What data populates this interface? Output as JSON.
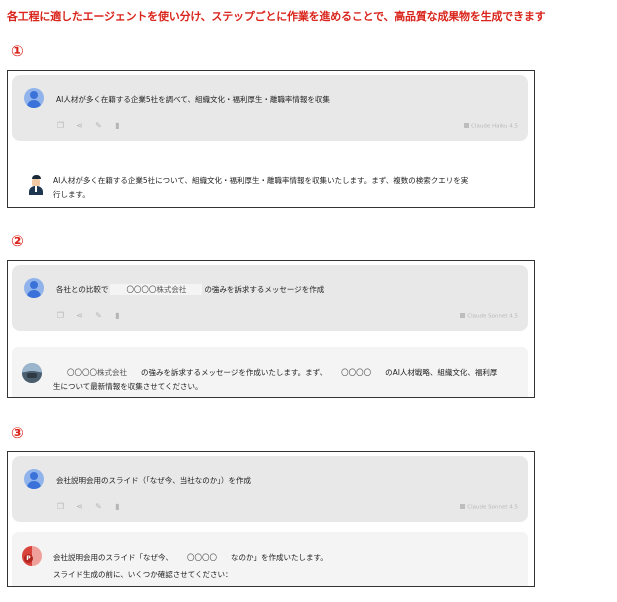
{
  "headline": "各工程に適したエージェントを使い分け、ステップごとに作業を進めることで、高品質な成果物を生成できます",
  "icons": [
    "copy-icon",
    "share-icon",
    "edit-icon",
    "delete-icon"
  ],
  "colors": {
    "accent": "#d9251c",
    "card": "#e8e8e8",
    "reply_bg": "#f4f4f4",
    "muted": "#b5b5b5"
  },
  "steps": [
    {
      "number": "①",
      "prompt": {
        "text": "AI人材が多く在籍する企業5社を調べて、組織文化・福利厚生・離職率情報を収集"
      },
      "model": "Claude Haiku 4.5",
      "reply": {
        "line1": "AI人材が多く在籍する企業5社について、組織文化・福利厚生・離職率情報を収集いたします。まず、複数の検索クエリを実",
        "line2": "行します。"
      }
    },
    {
      "number": "②",
      "prompt": {
        "before": "各社との比較で",
        "mask": "〇〇〇〇株式会社",
        "after": "の強みを訴求するメッセージを作成"
      },
      "model": "Claude Sonnet 4.5",
      "reply": {
        "l1_mask1": "〇〇〇〇株式会社",
        "l1_mid": "の強みを訴求するメッセージを作成いたします。まず、",
        "l1_mask2": "〇〇〇〇",
        "l1_end": "のAI人材戦略、組織文化、福利厚",
        "line2": "生について最新情報を収集させてください。"
      }
    },
    {
      "number": "③",
      "prompt": {
        "text": "会社説明会用のスライド（「なぜ今、当社なのか」）を作成"
      },
      "model": "Claude Sonnet 4.5",
      "reply": {
        "l1_before": "会社説明会用のスライド「なぜ今、",
        "l1_mask": "〇〇〇〇",
        "l1_after": "なのか」を作成いたします。",
        "line2": "スライド生成の前に、いくつか確認させてください："
      }
    }
  ]
}
